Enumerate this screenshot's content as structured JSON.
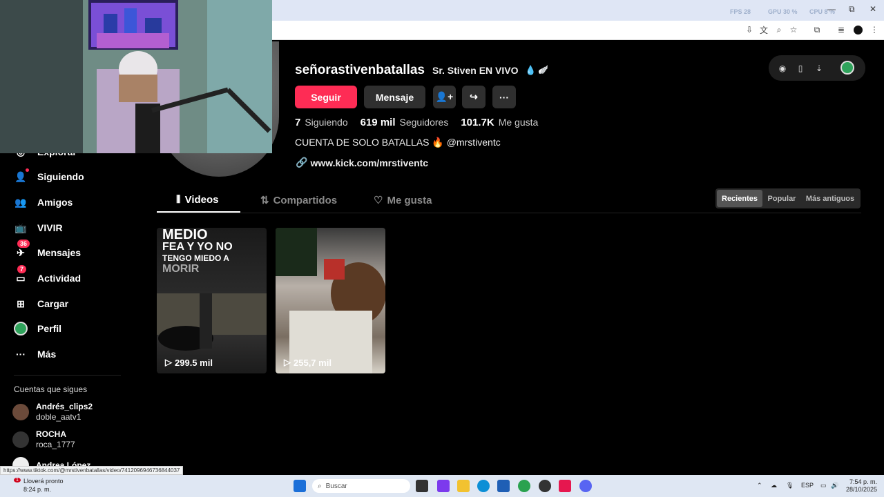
{
  "browser": {
    "stats": [
      "FPS  28",
      "GPU 30 %",
      "CPU  8 %"
    ],
    "window_controls": [
      "—",
      "⧉",
      "✕"
    ]
  },
  "sidebar": {
    "items": [
      {
        "label": "Explorar",
        "icon": "compass-icon"
      },
      {
        "label": "Siguiendo",
        "icon": "following-icon"
      },
      {
        "label": "Amigos",
        "icon": "friends-icon"
      },
      {
        "label": "VIVIR",
        "icon": "live-icon"
      },
      {
        "label": "Mensajes",
        "icon": "messages-icon",
        "badge": "36"
      },
      {
        "label": "Actividad",
        "icon": "activity-icon",
        "badge": "7"
      },
      {
        "label": "Cargar",
        "icon": "upload-icon"
      },
      {
        "label": "Perfil",
        "icon": "profile-avatar"
      },
      {
        "label": "Más",
        "icon": "more-icon"
      }
    ],
    "following_title": "Cuentas que sigues",
    "following": [
      {
        "name": "Andrés_clips2",
        "handle": "doble_aatv1"
      },
      {
        "name": "ROCHA",
        "handle": "roca_1777"
      },
      {
        "name": "Andrea López",
        "handle": ""
      }
    ]
  },
  "profile": {
    "username": "señorastivenbatallas",
    "display_name": "Sr. Stiven EN VIVO",
    "follow_label": "Seguir",
    "message_label": "Mensaje",
    "following_count": "7",
    "following_label": "Siguiendo",
    "followers_count": "619 mil",
    "followers_label": "Seguidores",
    "likes_count": "101.7K",
    "likes_label": "Me gusta",
    "bio": "CUENTA DE SOLO BATALLAS 🔥 @mrstiventc",
    "link": "www.kick.com/mrstiventc"
  },
  "tabs": [
    {
      "label": "Videos",
      "active": true
    },
    {
      "label": "Compartidos",
      "active": false
    },
    {
      "label": "Me gusta",
      "active": false
    }
  ],
  "sort": [
    {
      "label": "Recientes",
      "active": true
    },
    {
      "label": "Popular",
      "active": false
    },
    {
      "label": "Más antiguos",
      "active": false
    }
  ],
  "videos": [
    {
      "title_lines": [
        "MEDIO",
        "FEA Y YO NO",
        "TENGO MIEDO A",
        "MORIR"
      ],
      "views": "299.5 mil"
    },
    {
      "title_lines": [],
      "views": "255,7 mil"
    }
  ],
  "status_url": "https://www.tiktok.com/@mrstivenbatallas/video/7412096946736844037",
  "taskbar": {
    "weather_title": "Lloverá pronto",
    "weather_time": "8:24 p. m.",
    "weather_badge": "1",
    "search_placeholder": "Buscar",
    "lang": "ESP",
    "time": "7:54 p. m.",
    "date": "28/10/2025"
  },
  "colors": {
    "accent": "#fe2c55",
    "background": "#000000"
  }
}
